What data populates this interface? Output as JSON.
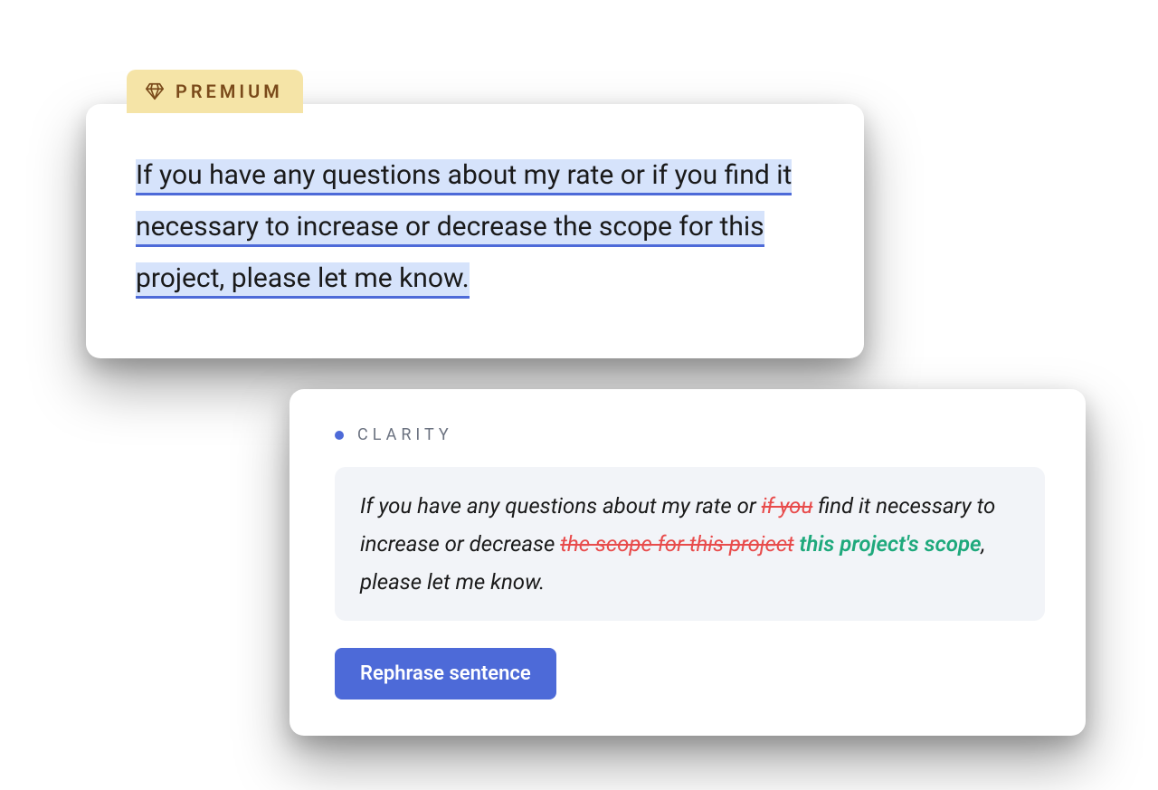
{
  "badge": {
    "label": "PREMIUM"
  },
  "editor": {
    "text": "If you have any questions about my rate or if you find it necessary to increase or decrease the scope for this project, please let me know."
  },
  "suggestion": {
    "category": "CLARITY",
    "parts": {
      "p1": "If you have any questions about my rate or ",
      "s1": "if you",
      "p2": " find it necessary to increase or decrease ",
      "s2": "the scope for this project",
      "a1": "this project's scope",
      "p3": ", please let me know."
    },
    "button_label": "Rephrase sentence"
  }
}
